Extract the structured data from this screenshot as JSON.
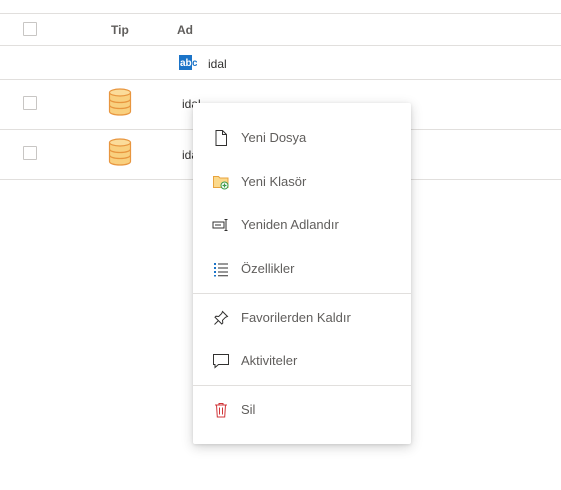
{
  "table": {
    "columns": {
      "type": "Tip",
      "name": "Ad"
    },
    "rows": [
      {
        "name": "idal",
        "icon": "text-type-icon"
      },
      {
        "name": "idal",
        "icon": "database-icon"
      },
      {
        "name": "idal",
        "icon": "database-icon"
      }
    ]
  },
  "context_menu": {
    "items": [
      {
        "label": "Yeni Dosya",
        "icon": "new-file-icon"
      },
      {
        "label": "Yeni Klasör",
        "icon": "new-folder-icon"
      },
      {
        "label": "Yeniden Adlandır",
        "icon": "rename-icon"
      },
      {
        "label": "Özellikler",
        "icon": "properties-list-icon"
      },
      {
        "label": "Favorilerden Kaldır",
        "icon": "unpin-icon"
      },
      {
        "label": "Aktiviteler",
        "icon": "comment-icon"
      },
      {
        "label": "Sil",
        "icon": "trash-icon"
      }
    ]
  },
  "colors": {
    "divider": "#e1dfdd",
    "text": "#323130",
    "menu_text": "#605e5c",
    "db_fill": "#f9d07f",
    "db_stroke": "#e8963f",
    "abc_blue": "#1b74c8",
    "delete_red": "#d13438",
    "folder_orange": "#e8a33d",
    "add_green": "#3a9b4a"
  }
}
